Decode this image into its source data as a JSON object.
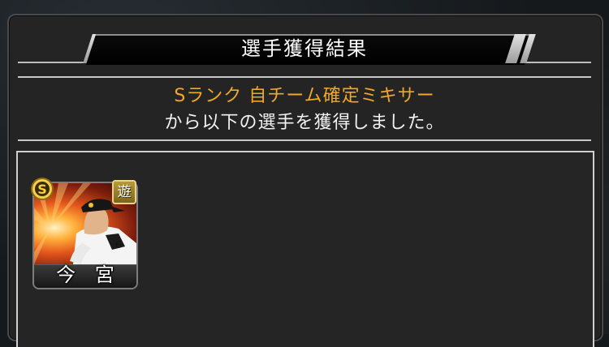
{
  "dialog": {
    "title": "選手獲得結果",
    "message_line1": "Sランク 自チーム確定ミキサー",
    "message_line2": "から以下の選手を獲得しました。"
  },
  "cards": [
    {
      "player_name": "今 宮",
      "rank": "S",
      "position": "遊"
    }
  ],
  "colors": {
    "accent": "#f0a72a",
    "text": "#f2f2f2",
    "panel": "#242424"
  }
}
